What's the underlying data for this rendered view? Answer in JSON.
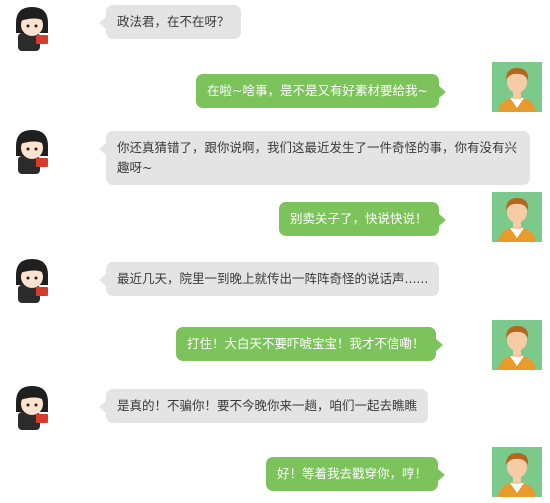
{
  "colors": {
    "bubble_left": "#e4e4e4",
    "bubble_right": "#7cc35b",
    "avatar_bg": "#7bc98b"
  },
  "messages": [
    {
      "side": "left",
      "avatar": "girl-avatar-icon",
      "text": "政法君，在不在呀？"
    },
    {
      "side": "right",
      "avatar": "boy-avatar-icon",
      "text": "在啦~啥事，是不是又有好素材要给我~"
    },
    {
      "side": "left",
      "avatar": "girl-avatar-icon",
      "text": "你还真猜错了，跟你说啊，我们这最近发生了一件奇怪的事，你有没有兴趣呀~"
    },
    {
      "side": "right",
      "avatar": "boy-avatar-icon",
      "text": "别卖关子了，快说快说！"
    },
    {
      "side": "left",
      "avatar": "girl-avatar-icon",
      "text": "最近几天，院里一到晚上就传出一阵阵奇怪的说话声......"
    },
    {
      "side": "right",
      "avatar": "boy-avatar-icon",
      "text": "打住！大白天不要吓唬宝宝！我才不信嘞！"
    },
    {
      "side": "left",
      "avatar": "girl-avatar-icon",
      "text": "是真的！不骗你！要不今晚你来一趟，咱们一起去瞧瞧"
    },
    {
      "side": "right",
      "avatar": "boy-avatar-icon",
      "text": "好！等着我去戳穿你，哼！"
    }
  ]
}
